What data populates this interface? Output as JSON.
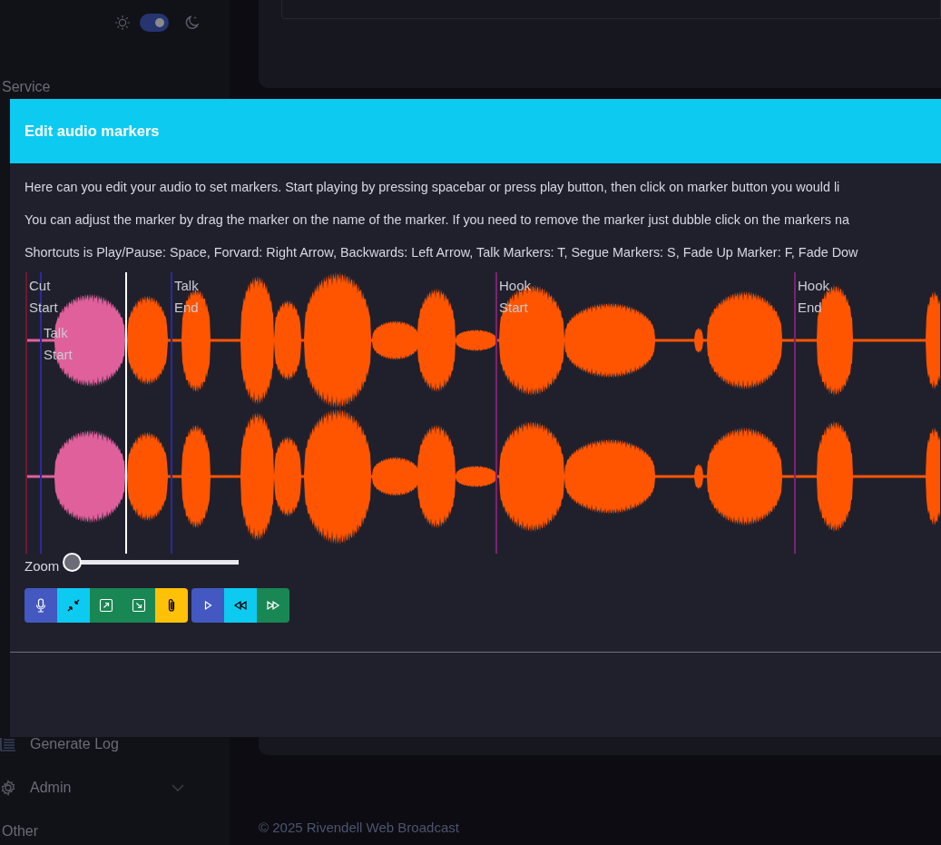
{
  "theme_toggle": {
    "on": true
  },
  "sidebar": {
    "items": [
      {
        "kind": "heading",
        "label": "Service"
      },
      {
        "kind": "link",
        "label": "Generate Log"
      },
      {
        "kind": "menu",
        "label": "Admin",
        "expanded": false
      },
      {
        "kind": "heading",
        "label": "Other"
      }
    ]
  },
  "dialog": {
    "title": "Edit audio markers",
    "paragraphs": [
      "Here can you edit your audio to set markers. Start playing by pressing spacebar or press play button, then click on marker button you would li",
      "You can adjust the marker by drag the marker on the name of the marker. If you need to remove the marker just dubble click on the markers na",
      "Shortcuts is Play/Pause: Space, Forvard: Right Arrow, Backwards: Left Arrow, Talk Markers: T, Segue Markers: S, Fade Up Marker: F, Fade Dow"
    ],
    "markers": [
      {
        "label": "Cut Start",
        "color": "#6e1a2c"
      },
      {
        "label": "Talk Start",
        "color": "#2b2b9c"
      },
      {
        "label": "Talk End",
        "color": "#2b2b9c"
      },
      {
        "label": "Hook Start",
        "color": "#7e2270"
      },
      {
        "label": "Hook End",
        "color": "#7e2270"
      }
    ],
    "zoom": {
      "label": "Zoom",
      "level": 0
    },
    "toolbar_groups": [
      [
        {
          "kind": "mic"
        },
        {
          "kind": "compress"
        },
        {
          "kind": "arrow-up-right"
        },
        {
          "kind": "arrow-down-right"
        },
        {
          "kind": "paperclip"
        }
      ],
      [
        {
          "kind": "play"
        },
        {
          "kind": "rewind"
        },
        {
          "kind": "fast-forward"
        }
      ]
    ]
  },
  "footer": "© 2025 Rivendell Web Broadcast"
}
